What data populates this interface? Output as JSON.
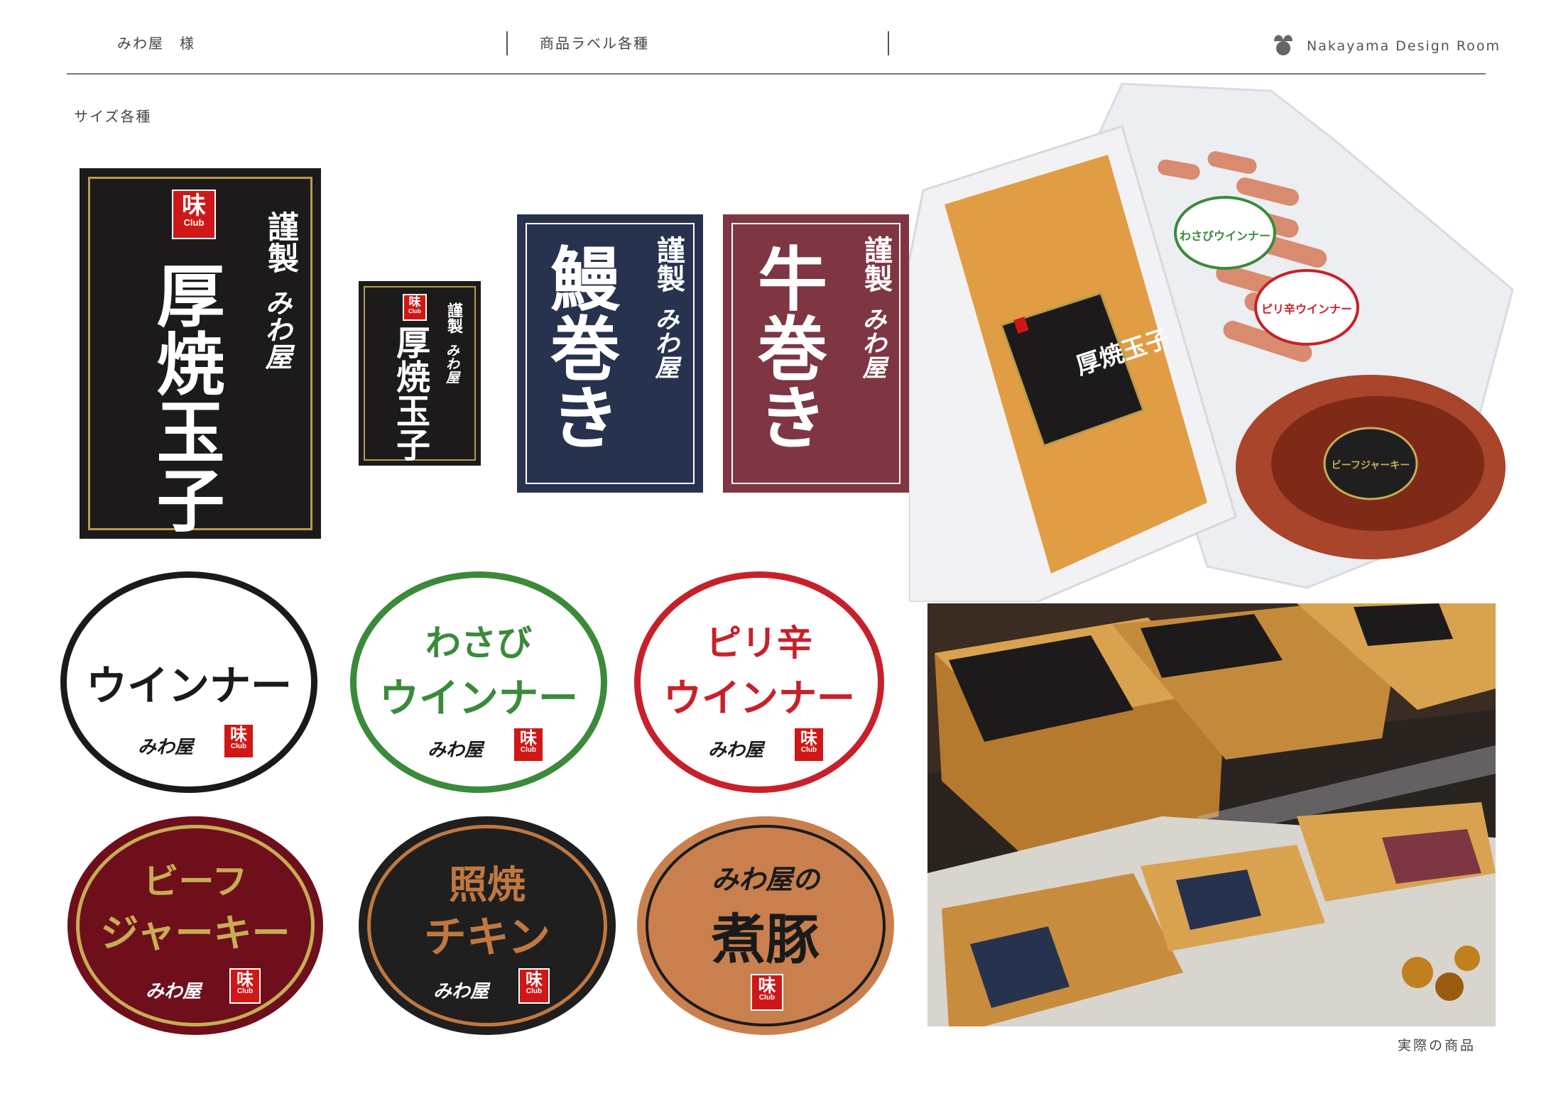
{
  "header": {
    "client": "みわ屋　様",
    "project": "商品ラベル各種",
    "studio": "Nakayama Design Room",
    "logo_icon": "sprout-icon"
  },
  "section_title": "サイズ各種",
  "rect_labels": {
    "tamago_large": {
      "prefix": "謹製",
      "brand": "みわ屋",
      "product": "厚焼玉子",
      "badge": "味",
      "badge_sub": "Club"
    },
    "tamago_small": {
      "prefix": "謹製",
      "brand": "みわ屋",
      "product": "厚焼玉子",
      "badge": "味",
      "badge_sub": "Club"
    },
    "unagi": {
      "prefix": "謹製",
      "brand": "みわ屋",
      "product": "鰻巻き",
      "color": "#27324f"
    },
    "gyu": {
      "prefix": "謹製",
      "brand": "みわ屋",
      "product": "牛巻き",
      "color": "#7e3643"
    }
  },
  "stickers": {
    "wiener": {
      "line1": "",
      "line2": "ウインナー",
      "brand": "みわ屋",
      "badge": "味",
      "badge_sub": "Club",
      "color": "#1a1a1a"
    },
    "wasabi": {
      "line1": "わさび",
      "line2": "ウインナー",
      "brand": "みわ屋",
      "badge": "味",
      "badge_sub": "Club",
      "color": "#3a8a3a"
    },
    "pirikara": {
      "line1": "ピリ辛",
      "line2": "ウインナー",
      "brand": "みわ屋",
      "badge": "味",
      "badge_sub": "Club",
      "color": "#c8202a"
    },
    "jerky": {
      "line1": "ビーフ",
      "line2": "ジャーキー",
      "brand": "みわ屋",
      "badge": "味",
      "badge_sub": "Club",
      "color": "#6e0f1b"
    },
    "teriyaki": {
      "line1": "照焼",
      "line2": "チキン",
      "brand": "みわ屋",
      "badge": "味",
      "badge_sub": "Club",
      "color": "#1f1f1f"
    },
    "nibuta": {
      "line1": "みわ屋の",
      "line2": "煮豚",
      "badge": "味",
      "badge_sub": "Club",
      "color": "#c9804e"
    }
  },
  "photos": {
    "package_photo": {
      "tamago_label": "厚焼玉子",
      "wasabi_label": "わさびウインナー",
      "pirikara_label": "ピリ辛ウインナー",
      "jerky_label": "ビーフジャーキー"
    },
    "store_photo": {
      "caption": "実際の商品"
    }
  }
}
